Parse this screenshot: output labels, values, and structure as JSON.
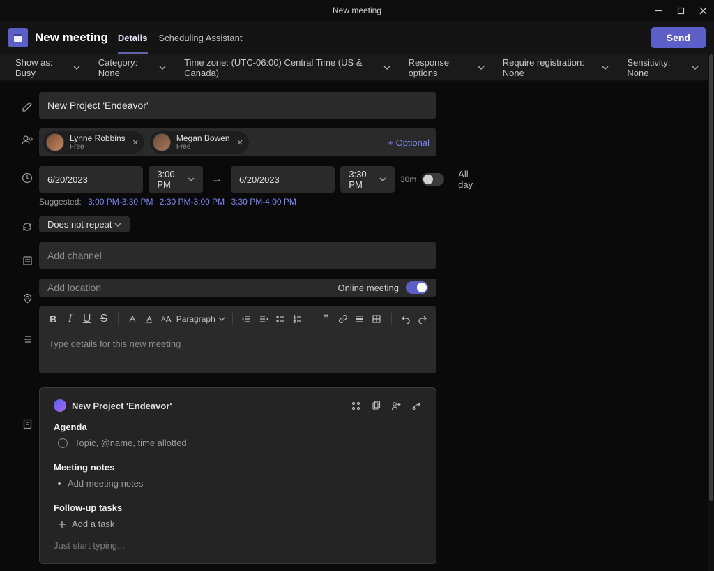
{
  "window": {
    "title": "New meeting"
  },
  "header": {
    "app_title": "New meeting",
    "tabs": {
      "details": "Details",
      "scheduling": "Scheduling Assistant"
    },
    "send": "Send"
  },
  "options": {
    "show_as": "Show as: Busy",
    "category": "Category: None",
    "timezone": "Time zone: (UTC-06:00) Central Time (US & Canada)",
    "response": "Response options",
    "registration": "Require registration: None",
    "sensitivity": "Sensitivity: None"
  },
  "form": {
    "title_value": "New Project 'Endeavor'",
    "attendees": [
      {
        "name": "Lynne Robbins",
        "status": "Free"
      },
      {
        "name": "Megan Bowen",
        "status": "Free"
      }
    ],
    "optional_link": "+ Optional",
    "start_date": "6/20/2023",
    "start_time": "3:00 PM",
    "end_date": "6/20/2023",
    "end_time": "3:30 PM",
    "duration": "30m",
    "all_day_label": "All day",
    "suggested_label": "Suggested:",
    "suggested_times": [
      "3:00 PM-3:30 PM",
      "2:30 PM-3:00 PM",
      "3:30 PM-4:00 PM"
    ],
    "repeat": "Does not repeat",
    "channel_placeholder": "Add channel",
    "location_placeholder": "Add location",
    "online_label": "Online meeting",
    "paragraph_label": "Paragraph",
    "details_placeholder": "Type details for this new meeting"
  },
  "notes": {
    "title": "New Project 'Endeavor'",
    "agenda_h": "Agenda",
    "agenda_ph": "Topic, @name, time allotted",
    "mnotes_h": "Meeting notes",
    "mnotes_ph": "Add meeting notes",
    "tasks_h": "Follow-up tasks",
    "tasks_ph": "Add a task",
    "ghost": "Just start typing..."
  }
}
